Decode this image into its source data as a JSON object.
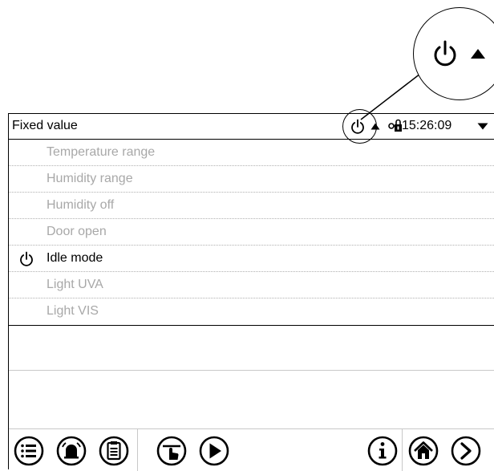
{
  "header": {
    "title": "Fixed value",
    "clock": "15:26:09"
  },
  "menu": {
    "items": [
      {
        "label": "Temperature range",
        "state": "disabled"
      },
      {
        "label": "Humidity range",
        "state": "disabled"
      },
      {
        "label": "Humidity off",
        "state": "disabled"
      },
      {
        "label": "Door open",
        "state": "disabled"
      },
      {
        "label": "Idle mode",
        "state": "active",
        "icon": "power-icon"
      },
      {
        "label": "Light UVA",
        "state": "disabled"
      },
      {
        "label": "Light VIS",
        "state": "disabled"
      }
    ]
  },
  "toolbar": {
    "buttons": [
      "menu-list-icon",
      "alarm-bell-icon",
      "clipboard-icon",
      "manual-mode-icon",
      "play-icon",
      "info-icon",
      "home-icon",
      "next-arrow-icon"
    ]
  },
  "colors": {
    "text": "#000000",
    "disabled_text": "#a8a8a8",
    "divider": "#c8c8c8"
  }
}
